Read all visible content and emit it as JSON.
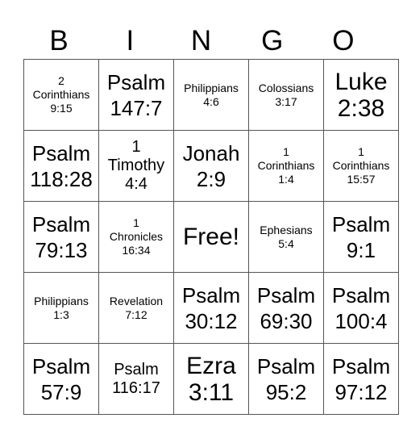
{
  "header": [
    "B",
    "I",
    "N",
    "G",
    "O"
  ],
  "rows": [
    [
      {
        "text": "2\nCorinthians\n9:15",
        "size": "s"
      },
      {
        "text": "Psalm\n147:7",
        "size": "l"
      },
      {
        "text": "Philippians\n4:6",
        "size": "s"
      },
      {
        "text": "Colossians\n3:17",
        "size": "s"
      },
      {
        "text": "Luke\n2:38",
        "size": "xl"
      }
    ],
    [
      {
        "text": "Psalm\n118:28",
        "size": "l"
      },
      {
        "text": "1\nTimothy\n4:4",
        "size": "m"
      },
      {
        "text": "Jonah\n2:9",
        "size": "l"
      },
      {
        "text": "1\nCorinthians\n1:4",
        "size": "s"
      },
      {
        "text": "1\nCorinthians\n15:57",
        "size": "s"
      }
    ],
    [
      {
        "text": "Psalm\n79:13",
        "size": "l"
      },
      {
        "text": "1\nChronicles\n16:34",
        "size": "s"
      },
      {
        "text": "Free!",
        "size": "free"
      },
      {
        "text": "Ephesians\n5:4",
        "size": "s"
      },
      {
        "text": "Psalm\n9:1",
        "size": "l"
      }
    ],
    [
      {
        "text": "Philippians\n1:3",
        "size": "s"
      },
      {
        "text": "Revelation\n7:12",
        "size": "s"
      },
      {
        "text": "Psalm\n30:12",
        "size": "l"
      },
      {
        "text": "Psalm\n69:30",
        "size": "l"
      },
      {
        "text": "Psalm\n100:4",
        "size": "l"
      }
    ],
    [
      {
        "text": "Psalm\n57:9",
        "size": "l"
      },
      {
        "text": "Psalm\n116:17",
        "size": "m"
      },
      {
        "text": "Ezra\n3:11",
        "size": "xl"
      },
      {
        "text": "Psalm\n95:2",
        "size": "l"
      },
      {
        "text": "Psalm\n97:12",
        "size": "l"
      }
    ]
  ]
}
